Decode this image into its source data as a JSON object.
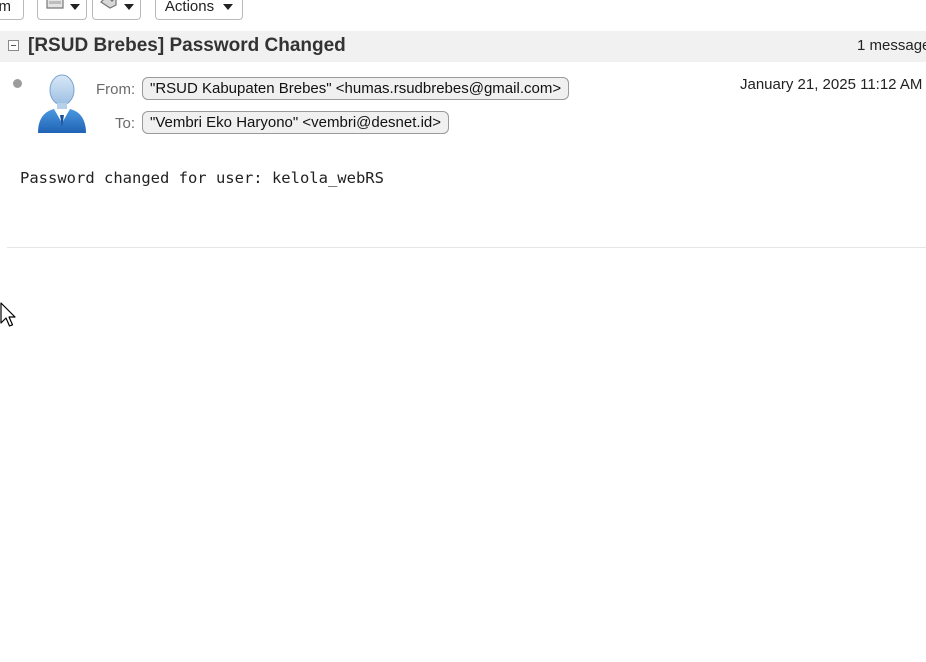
{
  "toolbar": {
    "partial_label": "m",
    "actions_label": "Actions",
    "move_icon": "folder-move-icon",
    "tag_icon": "tag-icon"
  },
  "subject": {
    "title": "[RSUD Brebes] Password Changed",
    "message_count": "1 message"
  },
  "message": {
    "from_label": "From:",
    "from_value": "\"RSUD Kabupaten Brebes\" <humas.rsudbrebes@gmail.com>",
    "to_label": "To:",
    "to_value": "\"Vembri Eko Haryono\" <vembri@desnet.id>",
    "date": "January 21, 2025 11:12 AM",
    "body": "Password changed for user: kelola_webRS"
  },
  "colors": {
    "subject_bar_bg": "#f1f1f1",
    "pill_bg": "#f0f0f0",
    "avatar_blue": "#2f7fd1"
  }
}
